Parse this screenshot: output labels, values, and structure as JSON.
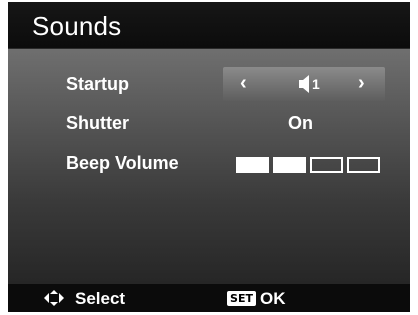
{
  "title": "Sounds",
  "settings": [
    {
      "label": "Startup",
      "value_number": "1",
      "icon": "speaker-icon",
      "left_arrow": "‹",
      "right_arrow": "›"
    },
    {
      "label": "Shutter",
      "value": "On"
    },
    {
      "label": "Beep Volume",
      "level": 2,
      "max_level": 4
    }
  ],
  "footer": {
    "select_icon": "dpad-icon",
    "select_label": "Select",
    "set_badge": "SET",
    "ok_label": "OK"
  },
  "colors": {
    "screen_bg": "#121212",
    "highlight": "#8b8b8b",
    "text": "#ffffff"
  }
}
